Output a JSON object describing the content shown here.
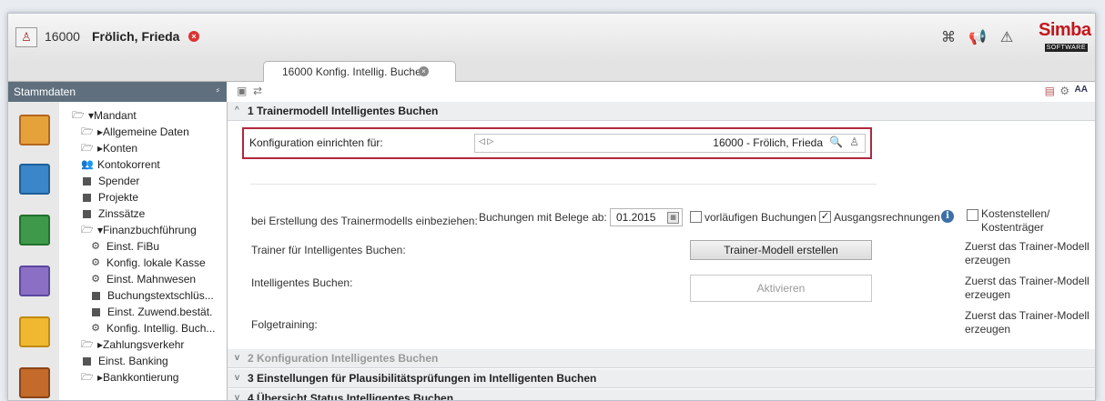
{
  "header": {
    "user_id": "16000",
    "user_name": "Frölich, Frieda",
    "logo_main": "Simba",
    "logo_sub": "SOFTWARE"
  },
  "tab": {
    "label": "16000 Konfig. Intellig. Buchen"
  },
  "sidebar": {
    "title": "Stammdaten",
    "tree": [
      {
        "label": "Mandant",
        "icon": "folder-open-icon"
      },
      {
        "label": "Allgemeine Daten",
        "icon": "folder-open-icon"
      },
      {
        "label": "Konten",
        "icon": "folder-open-icon"
      },
      {
        "label": "Kontokorrent",
        "icon": "people-icon"
      },
      {
        "label": "Spender",
        "icon": "square-icon"
      },
      {
        "label": "Projekte",
        "icon": "square-icon"
      },
      {
        "label": "Zinssätze",
        "icon": "square-icon"
      },
      {
        "label": "Finanzbuchführung",
        "icon": "folder-open-icon"
      },
      {
        "label": "Einst. FiBu",
        "icon": "gear-icon"
      },
      {
        "label": "Konfig. lokale Kasse",
        "icon": "gear-icon"
      },
      {
        "label": "Einst. Mahnwesen",
        "icon": "gear-icon"
      },
      {
        "label": "Buchungstextschlüs...",
        "icon": "square-icon"
      },
      {
        "label": "Einst. Zuwend.bestät.",
        "icon": "square-icon"
      },
      {
        "label": "Konfig. Intellig. Buch...",
        "icon": "gear-icon"
      },
      {
        "label": "Zahlungsverkehr",
        "icon": "folder-open-icon"
      },
      {
        "label": "Einst. Banking",
        "icon": "square-icon"
      },
      {
        "label": "Bankkontierung",
        "icon": "folder-open-icon"
      }
    ]
  },
  "sections": {
    "s1": "1 Trainermodell Intelligentes Buchen",
    "s2": "2 Konfiguration Intelligentes Buchen",
    "s3": "3 Einstellungen für Plausibilitätsprüfungen im Intelligenten Buchen",
    "s4": "4 Übersicht Status Intelligentes Buchen"
  },
  "config": {
    "label": "Konfiguration einrichten für:",
    "value": "16000 - Frölich, Frieda"
  },
  "form": {
    "include_label": "bei Erstellung des Trainermodells einbeziehen:",
    "bookings_label": "Buchungen mit Belege ab:",
    "date_value": "01.2015",
    "cb_vorlaeufig": "vorläufigen Buchungen",
    "cb_ausgang": "Ausgangsrechnungen",
    "cb_kosten_1": "Kostenstellen/",
    "cb_kosten_2": "Kostenträger",
    "trainer_label": "Trainer für Intelligentes Buchen:",
    "trainer_button": "Trainer-Modell erstellen",
    "ib_label": "Intelligentes Buchen:",
    "activate_button": "Aktivieren",
    "follow_label": "Folgetraining:",
    "note_1a": "Zuerst das Trainer-Modell",
    "note_1b": "erzeugen",
    "note_2a": "Zuerst das Trainer-Modell",
    "note_2b": "erzeugen",
    "note_3a": "Zuerst das Trainer-Modell",
    "note_3b": "erzeugen"
  },
  "toolbar": {
    "text_size": "AA"
  }
}
